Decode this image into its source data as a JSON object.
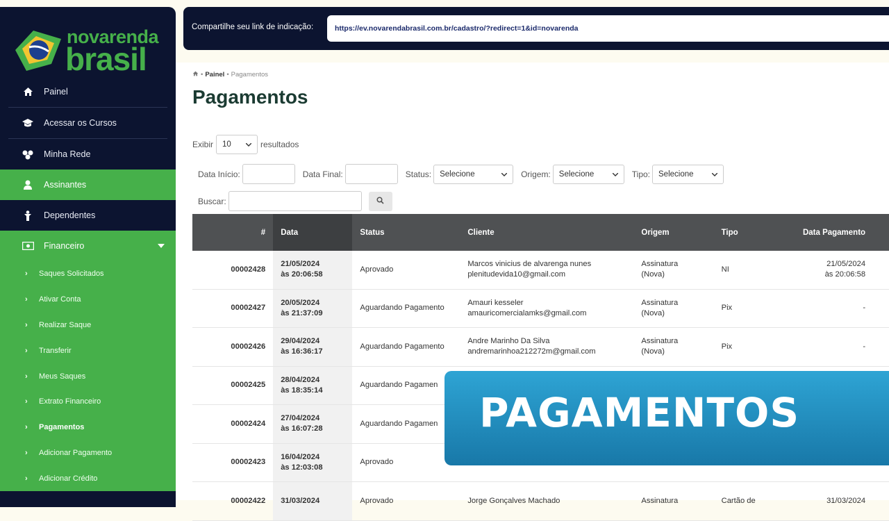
{
  "logo": {
    "line1_a": "nova",
    "line1_b": "renda",
    "line2": "brasil"
  },
  "menu": [
    {
      "label": "Painel",
      "icon": "home-icon"
    },
    {
      "label": "Acessar os Cursos",
      "icon": "graduation-cap-icon"
    },
    {
      "label": "Minha Rede",
      "icon": "network-icon"
    },
    {
      "label": "Assinantes",
      "icon": "user-icon"
    },
    {
      "label": "Dependentes",
      "icon": "child-icon"
    },
    {
      "label": "Financeiro",
      "icon": "money-icon"
    }
  ],
  "submenu": [
    "Saques Solicitados",
    "Ativar Conta",
    "Realizar Saque",
    "Transferir",
    "Meus Saques",
    "Extrato Financeiro",
    "Pagamentos",
    "Adicionar Pagamento",
    "Adicionar Crédito"
  ],
  "share": {
    "label": "Compartilhe seu link de indicação:",
    "url": "https://ev.novarendabrasil.com.br/cadastro/?redirect=1&id=novarenda"
  },
  "breadcrumb": {
    "home": "Painel",
    "current": "Pagamentos"
  },
  "page_title": "Pagamentos",
  "entries": {
    "prefix": "Exibir",
    "value": "10",
    "suffix": "resultados"
  },
  "filters": {
    "data_inicio": "Data Início:",
    "data_final": "Data Final:",
    "status": "Status:",
    "status_value": "Selecione",
    "origem": "Origem:",
    "origem_value": "Selecione",
    "tipo": "Tipo:",
    "tipo_value": "Selecione",
    "buscar": "Buscar:"
  },
  "table": {
    "headers": [
      "#",
      "Data",
      "Status",
      "Cliente",
      "Origem",
      "Tipo",
      "Data Pagamento"
    ],
    "rows": [
      {
        "num": "00002428",
        "date": "21/05/2024",
        "time": "às 20:06:58",
        "status": "Aprovado",
        "name": "Marcos vinicius de alvarenga nunes",
        "email": "plenitudevida10@gmail.com",
        "origem1": "Assinatura",
        "origem2": "(Nova)",
        "tipo": "NI",
        "pag1": "21/05/2024",
        "pag2": "às 20:06:58"
      },
      {
        "num": "00002427",
        "date": "20/05/2024",
        "time": "às 21:37:09",
        "status": "Aguardando Pagamento",
        "name": "Amauri kesseler",
        "email": "amauricomercialamks@gmail.com",
        "origem1": "Assinatura",
        "origem2": "(Nova)",
        "tipo": "Pix",
        "pag1": "-",
        "pag2": ""
      },
      {
        "num": "00002426",
        "date": "29/04/2024",
        "time": "às 16:36:17",
        "status": "Aguardando Pagamento",
        "name": "Andre Marinho Da Silva",
        "email": "andremarinhoa212272m@gmail.com",
        "origem1": "Assinatura",
        "origem2": "(Nova)",
        "tipo": "Pix",
        "pag1": "-",
        "pag2": ""
      },
      {
        "num": "00002425",
        "date": "28/04/2024",
        "time": "às 18:35:14",
        "status": "Aguardando Pagamen",
        "name": "",
        "email": "",
        "origem1": "",
        "origem2": "",
        "tipo": "",
        "pag1": "",
        "pag2": ""
      },
      {
        "num": "00002424",
        "date": "27/04/2024",
        "time": "às 16:07:28",
        "status": "Aguardando Pagamen",
        "name": "",
        "email": "",
        "origem1": "",
        "origem2": "",
        "tipo": "",
        "pag1": "",
        "pag2": ""
      },
      {
        "num": "00002423",
        "date": "16/04/2024",
        "time": "às 12:03:08",
        "status": "Aprovado",
        "name": "",
        "email": "",
        "origem1": "",
        "origem2": "",
        "tipo": "",
        "pag1": "",
        "pag2": ""
      },
      {
        "num": "00002422",
        "date": "31/03/2024",
        "time": "",
        "status": "Aprovado",
        "name": "Jorge Gonçalves Machado",
        "email": "",
        "origem1": "Assinatura",
        "origem2": "",
        "tipo": "Cartão de",
        "pag1": "31/03/2024",
        "pag2": ""
      }
    ]
  },
  "banner": {
    "text": "PAGAMENTOS"
  },
  "colors": {
    "navy": "#0c1430",
    "green": "#46b04a",
    "banner": "#2ea4d4"
  }
}
